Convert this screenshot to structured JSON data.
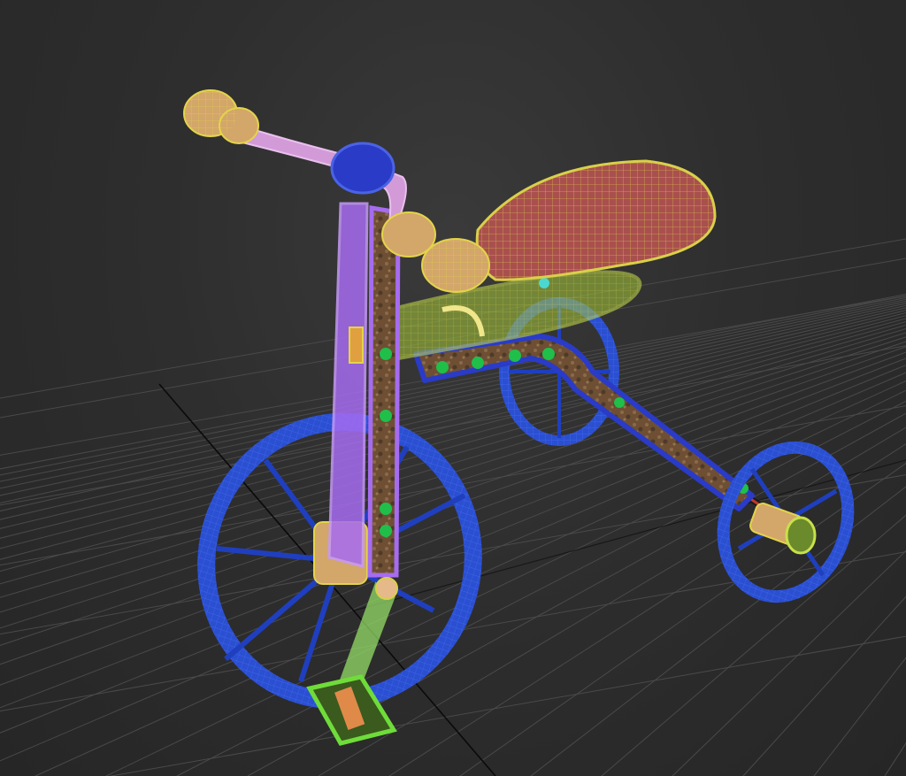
{
  "viewport": {
    "background": "#2b2b2b",
    "grid_color": "#4a4a4a",
    "axis_color": "#0a0a0a"
  },
  "model": {
    "object": "tricycle",
    "display_mode": "textured-wireframe",
    "colors": {
      "wheels": "#2b4fd1",
      "spokes": "#1f3fbf",
      "fork": "#a66cf0",
      "handlebar": "#d39ad8",
      "grips": "#e6b98a",
      "seat": "#a9504e",
      "seat_wire": "#d8d04a",
      "seat_support": "#c8e04a",
      "frame": "#2a3bc7",
      "rust": "#7a5a3e",
      "rivets": "#1fbf4a",
      "pedal": "#6fdc3a",
      "crank": "#9be86a",
      "axle": "#c0392b"
    }
  }
}
